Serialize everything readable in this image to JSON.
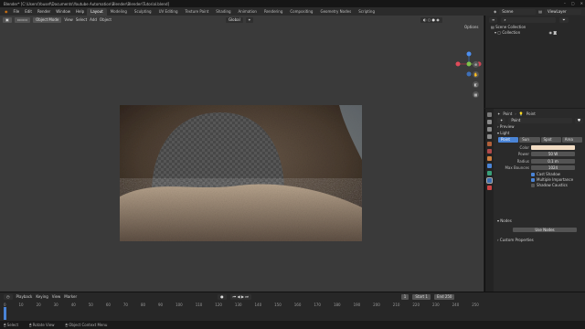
{
  "title_bar": {
    "text": "Blender* [C:\\Users\\Yousef\\Documents\\Youtube Automation\\Blender\\Blender\\Tutorial.blend]",
    "controls": [
      "–",
      "▢",
      "✕"
    ]
  },
  "menu": [
    "File",
    "Edit",
    "Render",
    "Window",
    "Help"
  ],
  "workspaces": [
    "Layout",
    "Modeling",
    "Sculpting",
    "UV Editing",
    "Texture Paint",
    "Shading",
    "Animation",
    "Rendering",
    "Compositing",
    "Geometry Nodes",
    "Scripting"
  ],
  "scene": {
    "label": "Scene",
    "view_layer": "ViewLayer"
  },
  "viewport_header": {
    "mode": "Object Mode",
    "view": "View",
    "select": "Select",
    "add": "Add",
    "object": "Object",
    "transform": "Global",
    "options": "Options"
  },
  "outliner": {
    "title": "Scene Collection",
    "collection": "Collection"
  },
  "properties": {
    "object_name": "Point",
    "object_name2": "Point",
    "data_name": "Point",
    "preview": "Preview",
    "light": "Light",
    "light_types": [
      "Point",
      "Sun",
      "Spot",
      "Area"
    ],
    "color_label": "Color",
    "power_label": "Power",
    "power_value": "50 W",
    "radius_label": "Radius",
    "radius_value": "0.1 m",
    "max_bounces_label": "Max Bounces",
    "max_bounces_value": "1024",
    "cast_shadow": "Cast Shadow",
    "multiple_importance": "Multiple Importance",
    "shadow_caustics": "Shadow Caustics",
    "nodes": "Nodes",
    "use_nodes": "Use Nodes",
    "custom_properties": "Custom Properties",
    "light_color": "#f2dcc3"
  },
  "timeline": {
    "playback": "Playback",
    "keying": "Keying",
    "view": "View",
    "marker": "Marker",
    "current_frame": "1",
    "start_label": "Start",
    "start": "1",
    "end_label": "End",
    "end": "250",
    "ticks": [
      "0",
      "10",
      "20",
      "30",
      "40",
      "50",
      "60",
      "70",
      "80",
      "90",
      "100",
      "110",
      "120",
      "130",
      "140",
      "150",
      "160",
      "170",
      "180",
      "190",
      "200",
      "210",
      "220",
      "230",
      "240",
      "250"
    ]
  },
  "status": [
    "Select",
    "Rotate View",
    "Object Context Menu"
  ],
  "colors": {
    "accent": "#4a84d6",
    "active_tab": "#3d6fb0"
  }
}
